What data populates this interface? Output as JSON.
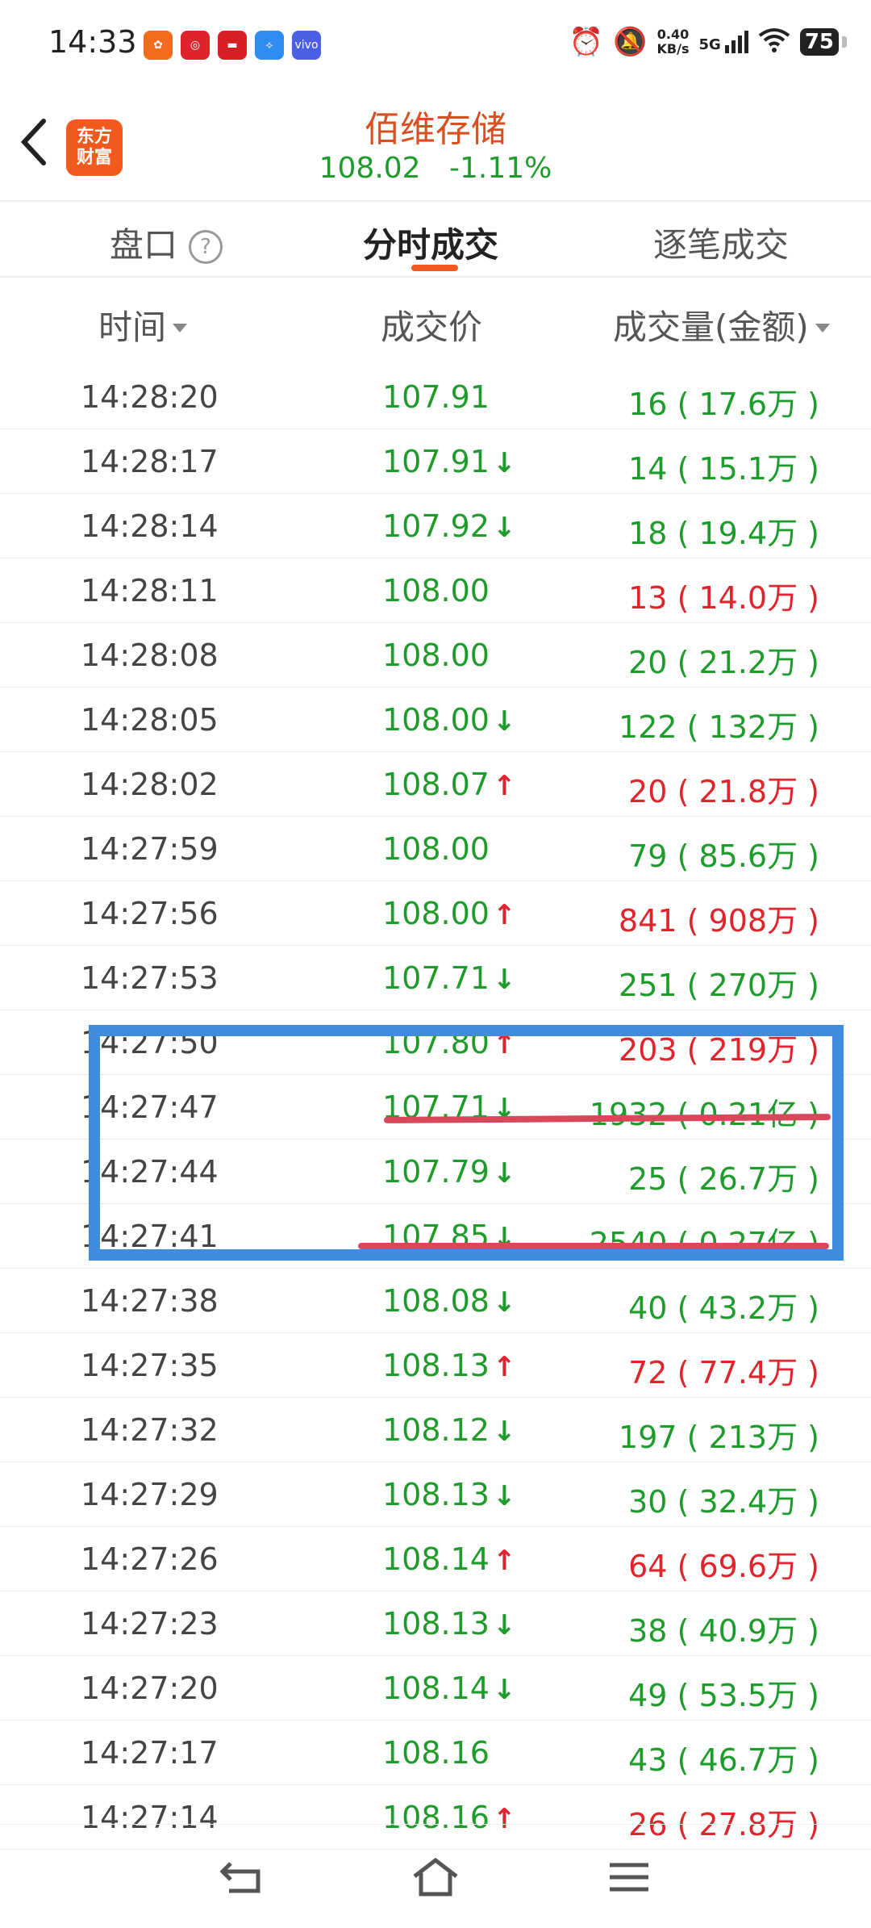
{
  "status_bar": {
    "time": "14:33",
    "apps": [
      {
        "name": "kuaishou-icon",
        "color": "#f36b1c",
        "glyph": "✿"
      },
      {
        "name": "netease-icon",
        "color": "#e0242b",
        "glyph": "◎"
      },
      {
        "name": "app-red-icon",
        "color": "#d81f26",
        "glyph": "▬"
      },
      {
        "name": "baidu-netdisk-icon",
        "color": "#2f8cf0",
        "glyph": "⟡"
      },
      {
        "name": "vivo-icon",
        "color": "#4b5fe6",
        "glyph": "vivo"
      }
    ],
    "net_speed": "0.40",
    "net_unit": "KB/s",
    "signal_label": "5G",
    "battery": "75"
  },
  "header": {
    "back_icon": "back-chevron-icon",
    "logo_text": "东方财富",
    "title": "佰维存储",
    "price": "108.02",
    "change": "-1.11%"
  },
  "tabs": [
    {
      "label": "盘口",
      "active": false
    },
    {
      "label": "分时成交",
      "active": true
    },
    {
      "label": "逐笔成交",
      "active": false
    }
  ],
  "help_icon": "?",
  "columns": {
    "time": "时间",
    "price": "成交价",
    "volume": "成交量(金额)"
  },
  "trades": [
    {
      "time": "14:28:20",
      "price": "107.91",
      "dir": "",
      "vol": "16",
      "amt": "17.6万",
      "vol_color": "green"
    },
    {
      "time": "14:28:17",
      "price": "107.91",
      "dir": "down",
      "vol": "14",
      "amt": "15.1万",
      "vol_color": "green"
    },
    {
      "time": "14:28:14",
      "price": "107.92",
      "dir": "down",
      "vol": "18",
      "amt": "19.4万",
      "vol_color": "green"
    },
    {
      "time": "14:28:11",
      "price": "108.00",
      "dir": "",
      "vol": "13",
      "amt": "14.0万",
      "vol_color": "red"
    },
    {
      "time": "14:28:08",
      "price": "108.00",
      "dir": "",
      "vol": "20",
      "amt": "21.2万",
      "vol_color": "green"
    },
    {
      "time": "14:28:05",
      "price": "108.00",
      "dir": "down",
      "vol": "122",
      "amt": "132万",
      "vol_color": "green"
    },
    {
      "time": "14:28:02",
      "price": "108.07",
      "dir": "up",
      "vol": "20",
      "amt": "21.8万",
      "vol_color": "red"
    },
    {
      "time": "14:27:59",
      "price": "108.00",
      "dir": "",
      "vol": "79",
      "amt": "85.6万",
      "vol_color": "green"
    },
    {
      "time": "14:27:56",
      "price": "108.00",
      "dir": "up",
      "vol": "841",
      "amt": "908万",
      "vol_color": "red"
    },
    {
      "time": "14:27:53",
      "price": "107.71",
      "dir": "down",
      "vol": "251",
      "amt": "270万",
      "vol_color": "green"
    },
    {
      "time": "14:27:50",
      "price": "107.80",
      "dir": "up",
      "vol": "203",
      "amt": "219万",
      "vol_color": "red"
    },
    {
      "time": "14:27:47",
      "price": "107.71",
      "dir": "down",
      "vol": "1932",
      "amt": "0.21亿",
      "vol_color": "green"
    },
    {
      "time": "14:27:44",
      "price": "107.79",
      "dir": "down",
      "vol": "25",
      "amt": "26.7万",
      "vol_color": "green"
    },
    {
      "time": "14:27:41",
      "price": "107.85",
      "dir": "down",
      "vol": "2540",
      "amt": "0.27亿",
      "vol_color": "green"
    },
    {
      "time": "14:27:38",
      "price": "108.08",
      "dir": "down",
      "vol": "40",
      "amt": "43.2万",
      "vol_color": "green"
    },
    {
      "time": "14:27:35",
      "price": "108.13",
      "dir": "up",
      "vol": "72",
      "amt": "77.4万",
      "vol_color": "red"
    },
    {
      "time": "14:27:32",
      "price": "108.12",
      "dir": "down",
      "vol": "197",
      "amt": "213万",
      "vol_color": "green"
    },
    {
      "time": "14:27:29",
      "price": "108.13",
      "dir": "down",
      "vol": "30",
      "amt": "32.4万",
      "vol_color": "green"
    },
    {
      "time": "14:27:26",
      "price": "108.14",
      "dir": "up",
      "vol": "64",
      "amt": "69.6万",
      "vol_color": "red"
    },
    {
      "time": "14:27:23",
      "price": "108.13",
      "dir": "down",
      "vol": "38",
      "amt": "40.9万",
      "vol_color": "green"
    },
    {
      "time": "14:27:20",
      "price": "108.14",
      "dir": "down",
      "vol": "49",
      "amt": "53.5万",
      "vol_color": "green"
    },
    {
      "time": "14:27:17",
      "price": "108.16",
      "dir": "",
      "vol": "43",
      "amt": "46.7万",
      "vol_color": "green"
    },
    {
      "time": "14:27:14",
      "price": "108.16",
      "dir": "up",
      "vol": "26",
      "amt": "27.8万",
      "vol_color": "red"
    }
  ],
  "colors": {
    "accent": "#f25a1d",
    "up": "#e0242b",
    "down": "#1e9c2b",
    "annotation_box": "#3f8be0",
    "annotation_line": "#d8475a"
  },
  "nav": [
    "back-nav-icon",
    "home-nav-icon",
    "menu-nav-icon"
  ]
}
